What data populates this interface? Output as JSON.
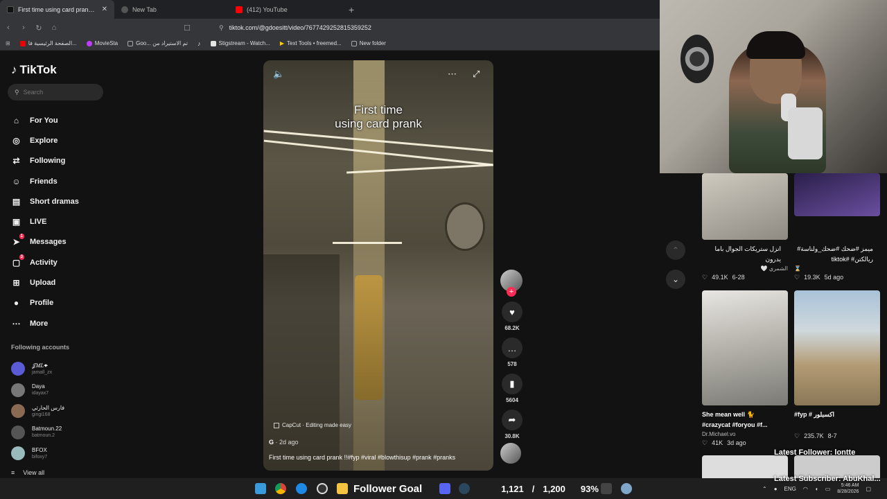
{
  "browser": {
    "tabs": [
      {
        "title": "First time using card prank !! #fy",
        "active": true,
        "favicon_color": "#111111"
      },
      {
        "title": "New Tab",
        "active": false,
        "favicon_color": "#555555"
      },
      {
        "title": "(412) YouTube",
        "active": false,
        "favicon_color": "#ff0000"
      }
    ],
    "url": "tiktok.com/@gdoesitt/video/7677429252815359252",
    "bookmarks": [
      {
        "label": "الصفحة الرئيسية فا...",
        "color": "#e00"
      },
      {
        "label": "MovieSta",
        "color": "#c13cff"
      },
      {
        "label": "Goo... تم الاستيراد من",
        "color": "#888"
      },
      {
        "label": "Stigstream - Watch...",
        "color": "#e6e6e6"
      },
      {
        "label": "Text Tools • freemed...",
        "color": "#ffcc00"
      },
      {
        "label": "New folder",
        "color": "#888"
      }
    ]
  },
  "sidebar": {
    "logo": "TikTok",
    "search_placeholder": "Search",
    "nav": [
      {
        "label": "For You",
        "icon": "home-icon",
        "glyph": "⌂",
        "badge": ""
      },
      {
        "label": "Explore",
        "icon": "compass-icon",
        "glyph": "◎",
        "badge": ""
      },
      {
        "label": "Following",
        "icon": "following-icon",
        "glyph": "⇄",
        "badge": ""
      },
      {
        "label": "Friends",
        "icon": "friends-icon",
        "glyph": "☺",
        "badge": ""
      },
      {
        "label": "Short dramas",
        "icon": "film-icon",
        "glyph": "▤",
        "badge": ""
      },
      {
        "label": "LIVE",
        "icon": "live-icon",
        "glyph": "▣",
        "badge": ""
      },
      {
        "label": "Messages",
        "icon": "send-icon",
        "glyph": "➤",
        "badge": "1"
      },
      {
        "label": "Activity",
        "icon": "inbox-icon",
        "glyph": "▢",
        "badge": "3"
      },
      {
        "label": "Upload",
        "icon": "upload-icon",
        "glyph": "⊞",
        "badge": ""
      },
      {
        "label": "Profile",
        "icon": "profile-icon",
        "glyph": "●",
        "badge": ""
      },
      {
        "label": "More",
        "icon": "more-icon",
        "glyph": "⋯",
        "badge": ""
      }
    ],
    "following_title": "Following accounts",
    "accounts": [
      {
        "name": "𝒥𝑀𝐿✦",
        "handle": "jamall_zx",
        "color": "#5b5bd6"
      },
      {
        "name": "Daya",
        "handle": "idayax7",
        "color": "#777"
      },
      {
        "name": "فارس الحارثي",
        "handle": "gingi168",
        "color": "#8a6a52"
      },
      {
        "name": "Batmoun.22",
        "handle": "batmoun.2",
        "color": "#555"
      },
      {
        "name": "BFOX",
        "handle": "bifoxy7",
        "color": "#9bb"
      }
    ],
    "view_all": "View all"
  },
  "video": {
    "overlay_title_line1": "First time",
    "overlay_title_line2": "using card prank",
    "capcut": "CapCut · Editing made easy",
    "author": "G",
    "age": "· 2d ago",
    "caption": "First time using card prank !!#fyp #viral #blowthisup #prank #pranks"
  },
  "actions": {
    "likes": "68.2K",
    "comments": "578",
    "saves": "5604",
    "shares": "30.8K"
  },
  "grid": [
    {
      "desc": "انزل ستريكات الجوال باما يدرون #الشعب_الصيني_ماله_حل 👀 ...",
      "sub": "الشمري 🤍",
      "likes": "49.1K",
      "date": "6-28",
      "colors": [
        "#cfcac0",
        "#8e8a82"
      ]
    },
    {
      "desc": "ميمز #ضحك #ضحك_ولناسة# ريالكتن# #tiktok",
      "sub": "⌛",
      "likes": "19.3K",
      "date": "5d ago",
      "colors": [
        "#2a1f4a",
        "#6b4fa0"
      ]
    },
    {
      "desc": "She mean well 🐈 #crazycat #foryou #f...",
      "sub": "Dr.Michael.vo",
      "likes": "41K",
      "date": "3d ago",
      "colors": [
        "#e8e6e2",
        "#7c7a74"
      ]
    },
    {
      "desc": "#fyp # اكسبلور",
      "sub": "",
      "likes": "235.7K",
      "date": "8-7",
      "colors": [
        "#a9c2d8",
        "#b39b74"
      ]
    }
  ],
  "stream": {
    "latest_follower": "Latest Follower: lontte",
    "latest_subscriber": "Latest Subscriber: AbuKhal...",
    "goal_label": "Follower Goal",
    "goal_current": "1,121",
    "goal_sep": "/",
    "goal_target": "1,200",
    "goal_pct": "93%"
  },
  "taskbar": {
    "lang": "ENG",
    "time": "5:46 AM",
    "date": "8/28/2026"
  }
}
